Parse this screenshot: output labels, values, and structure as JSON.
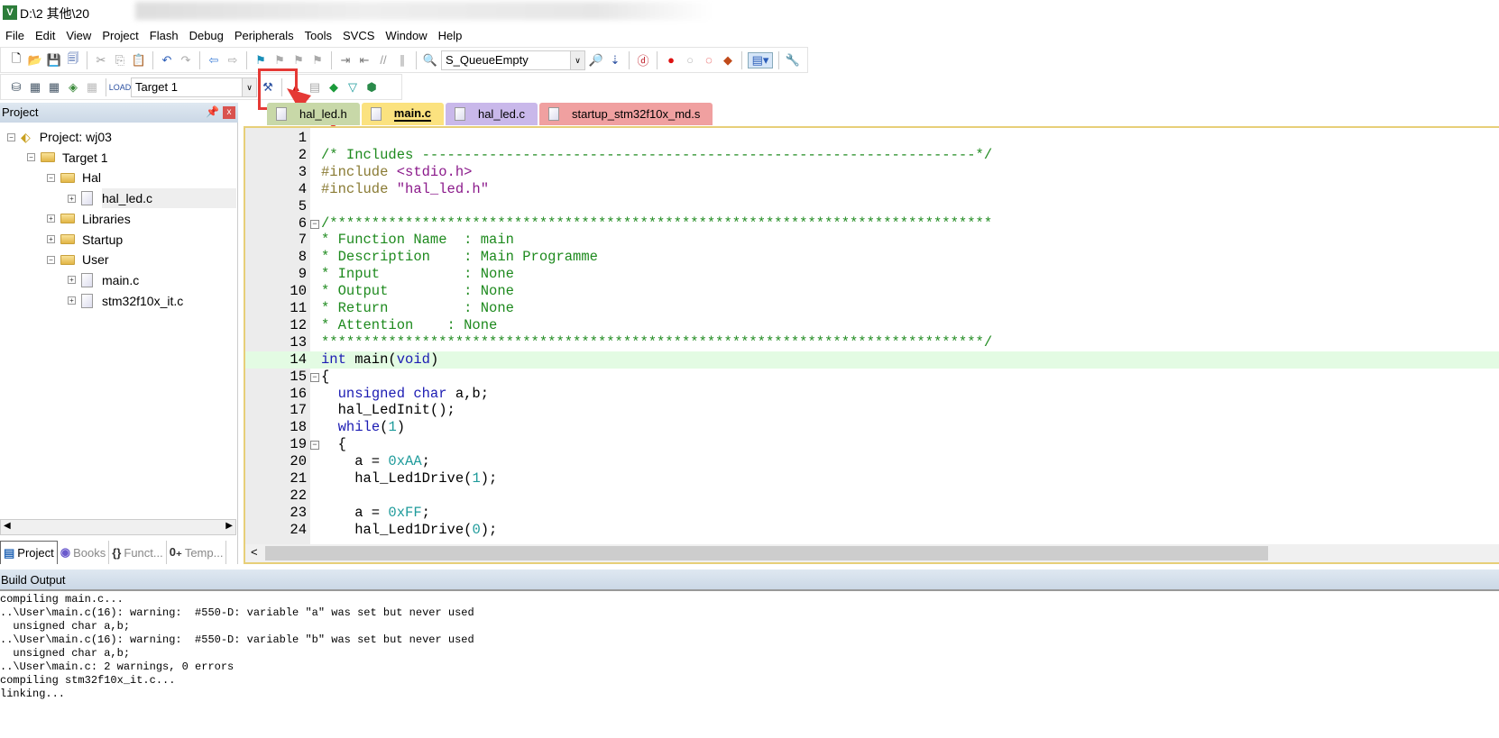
{
  "title": "D:\\2 其他\\20",
  "menu": [
    "File",
    "Edit",
    "View",
    "Project",
    "Flash",
    "Debug",
    "Peripherals",
    "Tools",
    "SVCS",
    "Window",
    "Help"
  ],
  "toolbar1": {
    "function_combo": "S_QueueEmpty"
  },
  "toolbar2": {
    "target_combo": "Target 1"
  },
  "project_panel": {
    "title": "Project",
    "tree": [
      {
        "label": "Project: wj03",
        "level": 0,
        "kind": "project",
        "expanded": true
      },
      {
        "label": "Target 1",
        "level": 1,
        "kind": "target",
        "expanded": true
      },
      {
        "label": "Hal",
        "level": 2,
        "kind": "folder",
        "expanded": true
      },
      {
        "label": "hal_led.c",
        "level": 3,
        "kind": "file",
        "selected": true
      },
      {
        "label": "Libraries",
        "level": 2,
        "kind": "folder",
        "expanded": false
      },
      {
        "label": "Startup",
        "level": 2,
        "kind": "folder",
        "expanded": false
      },
      {
        "label": "User",
        "level": 2,
        "kind": "folder",
        "expanded": true
      },
      {
        "label": "main.c",
        "level": 3,
        "kind": "file"
      },
      {
        "label": "stm32f10x_it.c",
        "level": 3,
        "kind": "file"
      }
    ],
    "tabs": [
      {
        "label": "Project",
        "active": true
      },
      {
        "label": "Books"
      },
      {
        "label": "Funct..."
      },
      {
        "label": "Temp..."
      }
    ]
  },
  "editor_tabs": [
    {
      "label": "hal_led.h",
      "color": "#c8d8a8"
    },
    {
      "label": "main.c",
      "color": "#fbe27f",
      "active": true
    },
    {
      "label": "hal_led.c",
      "color": "#c9b8ea"
    },
    {
      "label": "startup_stm32f10x_md.s",
      "color": "#f0a0a0"
    }
  ],
  "code": [
    [],
    [
      [
        "comment",
        "/* Includes ------------------------------------------------------------------*/"
      ]
    ],
    [
      [
        "pre",
        "#include "
      ],
      [
        "str",
        "<stdio.h>"
      ]
    ],
    [
      [
        "pre",
        "#include "
      ],
      [
        "str",
        "\"hal_led.h\""
      ]
    ],
    [],
    [
      [
        "comment",
        "/*******************************************************************************"
      ]
    ],
    [
      [
        "comment",
        "* Function Name  : main"
      ]
    ],
    [
      [
        "comment",
        "* Description    : Main Programme"
      ]
    ],
    [
      [
        "comment",
        "* Input          : None"
      ]
    ],
    [
      [
        "comment",
        "* Output         : None"
      ]
    ],
    [
      [
        "comment",
        "* Return         : None"
      ]
    ],
    [
      [
        "comment",
        "* Attention    : None"
      ]
    ],
    [
      [
        "comment",
        "*******************************************************************************/"
      ]
    ],
    [
      [
        "kw",
        "int"
      ],
      [
        "plain",
        " main("
      ],
      [
        "kw",
        "void"
      ],
      [
        "plain",
        ")"
      ]
    ],
    [
      [
        "plain",
        "{"
      ]
    ],
    [
      [
        "plain",
        "  "
      ],
      [
        "kw",
        "unsigned char"
      ],
      [
        "plain",
        " a,b;"
      ]
    ],
    [
      [
        "plain",
        "  hal_LedInit();"
      ]
    ],
    [
      [
        "plain",
        "  "
      ],
      [
        "kw",
        "while"
      ],
      [
        "plain",
        "("
      ],
      [
        "num",
        "1"
      ],
      [
        "plain",
        ")"
      ]
    ],
    [
      [
        "plain",
        "  {"
      ]
    ],
    [
      [
        "plain",
        "    a = "
      ],
      [
        "num",
        "0xAA"
      ],
      [
        "plain",
        ";"
      ]
    ],
    [
      [
        "plain",
        "    hal_Led1Drive("
      ],
      [
        "num",
        "1"
      ],
      [
        "plain",
        ");"
      ]
    ],
    [],
    [
      [
        "plain",
        "    a = "
      ],
      [
        "num",
        "0xFF"
      ],
      [
        "plain",
        ";"
      ]
    ],
    [
      [
        "plain",
        "    hal_Led1Drive("
      ],
      [
        "num",
        "0"
      ],
      [
        "plain",
        ");"
      ]
    ]
  ],
  "current_line": 14,
  "fold_lines": [
    6,
    15,
    19
  ],
  "build_output": {
    "title": "Build Output",
    "lines": [
      "compiling main.c...",
      "..\\User\\main.c(16): warning:  #550-D: variable \"a\" was set but never used",
      "  unsigned char a,b;",
      "..\\User\\main.c(16): warning:  #550-D: variable \"b\" was set but never used",
      "  unsigned char a,b;",
      "..\\User\\main.c: 2 warnings, 0 errors",
      "compiling stm32f10x_it.c...",
      "linking..."
    ]
  }
}
